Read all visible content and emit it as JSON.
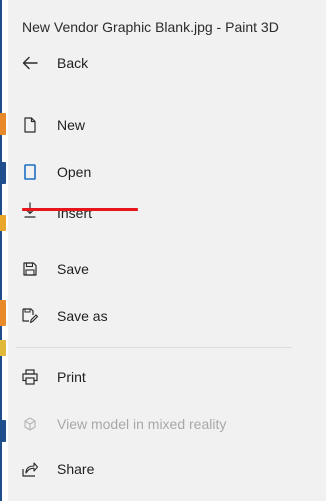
{
  "window": {
    "title": "New Vendor Graphic Blank.jpg - Paint 3D"
  },
  "menu": {
    "back": {
      "label": "Back",
      "icon": "arrow-left-icon"
    },
    "new": {
      "label": "New",
      "icon": "new-document-icon"
    },
    "open": {
      "label": "Open",
      "icon": "open-document-icon"
    },
    "insert": {
      "label": "Insert",
      "icon": "download-arrow-icon"
    },
    "save": {
      "label": "Save",
      "icon": "floppy-disk-icon"
    },
    "save_as": {
      "label": "Save as",
      "icon": "save-as-icon"
    },
    "print": {
      "label": "Print",
      "icon": "printer-icon"
    },
    "mixed_reality": {
      "label": "View model in mixed reality",
      "icon": "mixed-reality-icon",
      "enabled": false
    },
    "share": {
      "label": "Share",
      "icon": "share-icon"
    }
  },
  "colors": {
    "panel_background": "#f1f1f1",
    "open_icon_accent": "#1f6fc4",
    "annotation_underline": "#e8141b",
    "disabled_text": "#a8a8a8"
  }
}
